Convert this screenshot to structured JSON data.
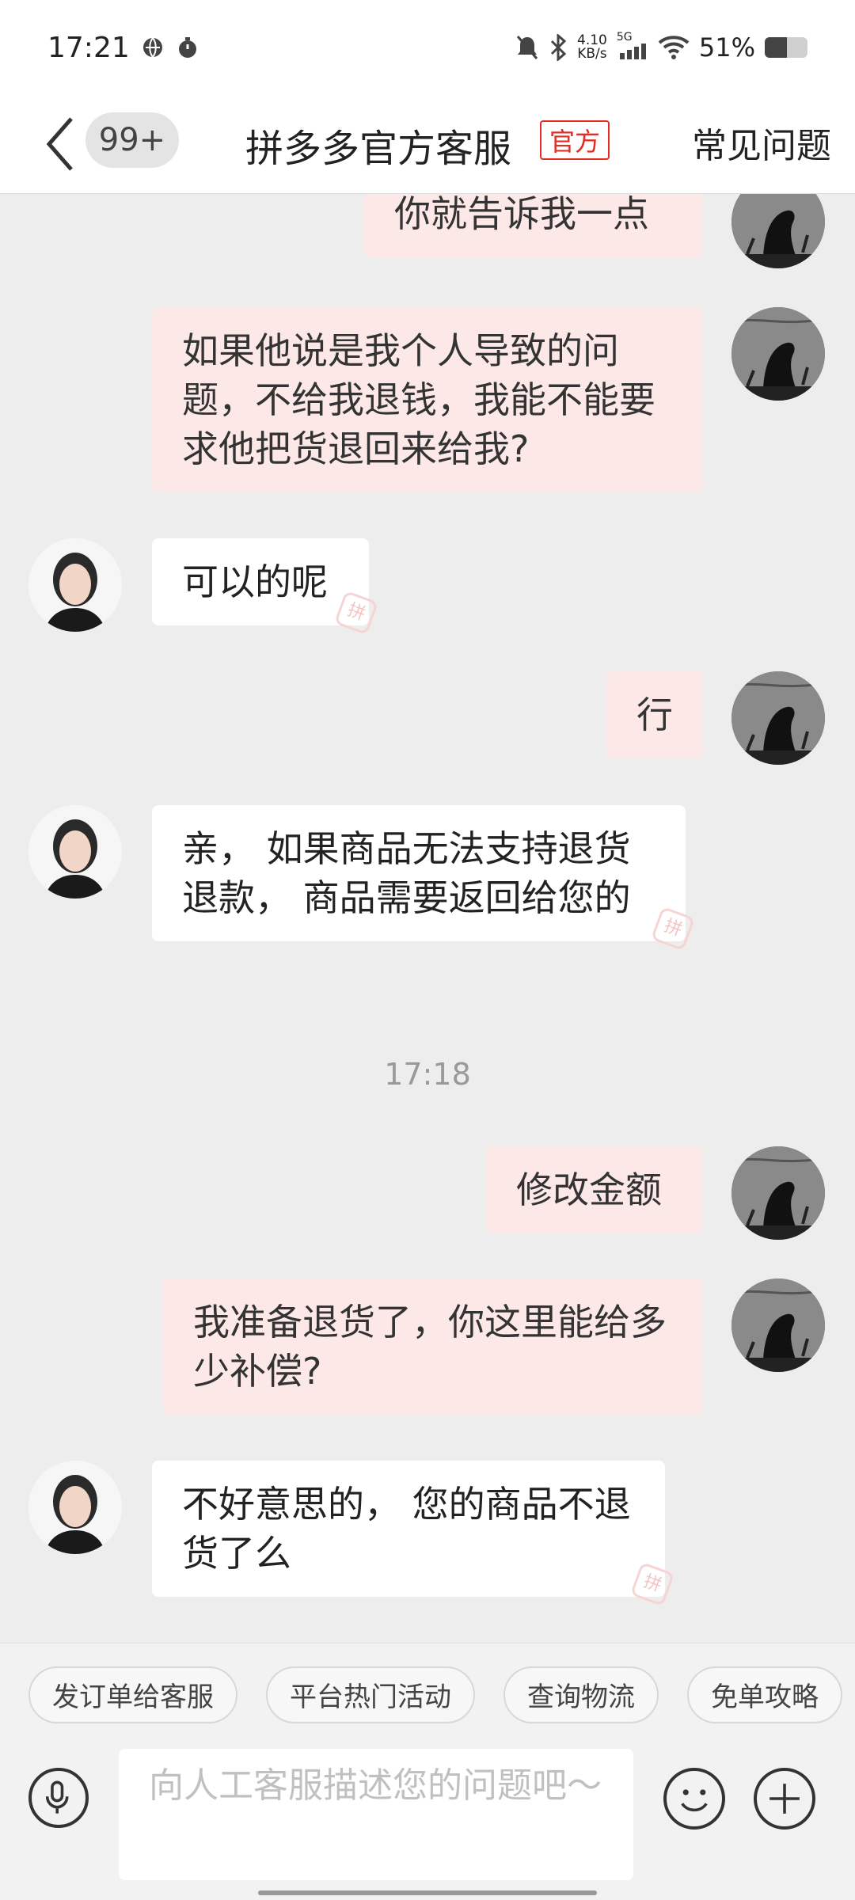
{
  "status_bar": {
    "time": "17:21",
    "net_speed_top": "4.10",
    "net_speed_bottom": "KB/s",
    "network": "5G",
    "battery": "51%",
    "battery_level": 0.51
  },
  "nav": {
    "unread": "99+",
    "title": "拼多多官方客服",
    "official_tag": "官方",
    "faq": "常见问题"
  },
  "messages": {
    "m1": "你就告诉我一点",
    "m2": "如果他说是我个人导致的问题，不给我退钱，我能不能要求他把货退回来给我?",
    "m3": "可以的呢",
    "m4": "行",
    "m5": "亲， 如果商品无法支持退货退款， 商品需要返回给您的",
    "timestamp": "17:18",
    "m6": "修改金额",
    "m7": "我准备退货了，你这里能给多少补偿?",
    "m8": "不好意思的， 您的商品不退货了么",
    "pin_mark": "拼"
  },
  "quick_replies": [
    "发订单给客服",
    "平台热门活动",
    "查询物流",
    "免单攻略"
  ],
  "input": {
    "placeholder": "向人工客服描述您的问题吧～"
  },
  "colors": {
    "brand_red": "#e02e24",
    "out_bubble": "#fde8e8",
    "in_bubble": "#ffffff",
    "background": "#ededed"
  }
}
